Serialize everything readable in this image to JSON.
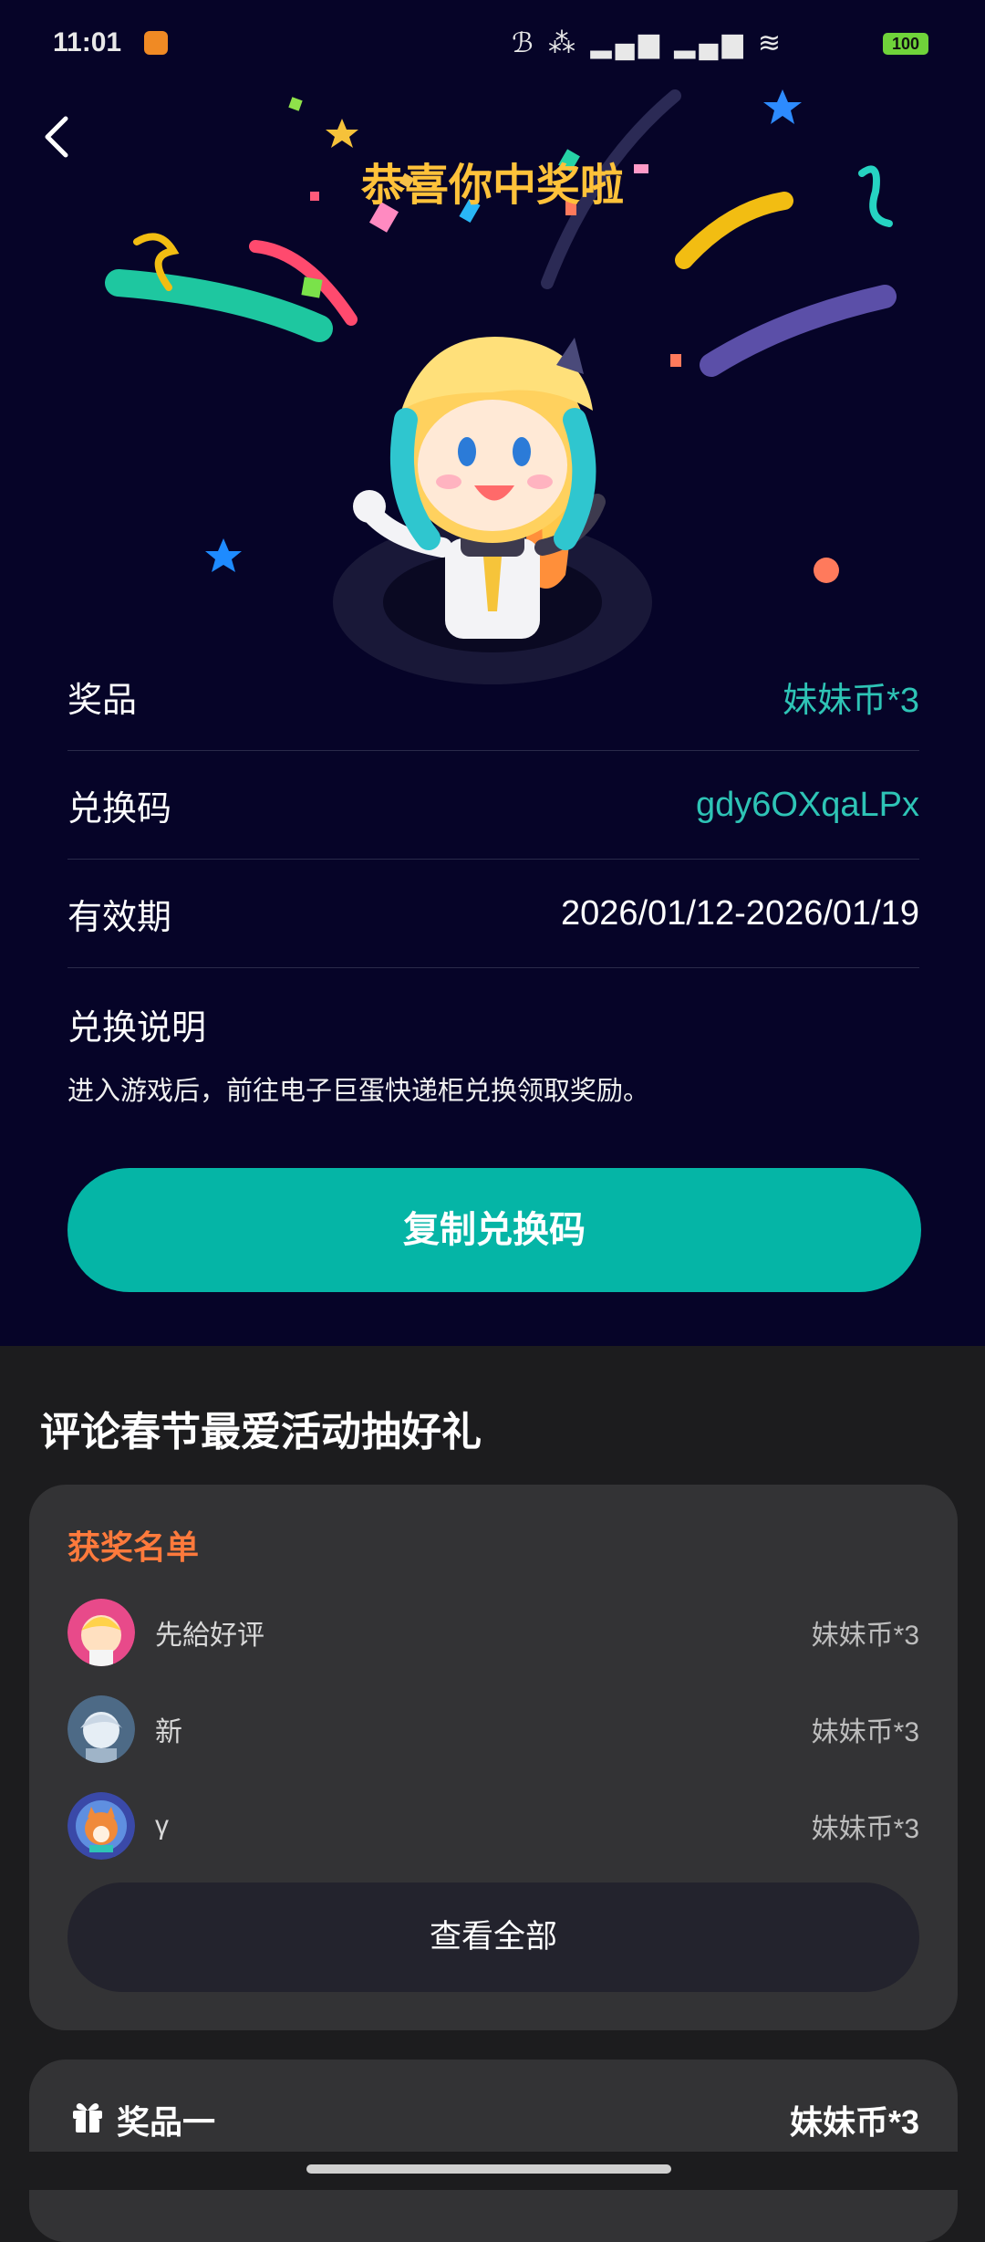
{
  "status_bar": {
    "time": "11:01",
    "signal": "ℬ ⁂ ▂▄▆ ▂▄▆ ≋",
    "battery": "100"
  },
  "hero": {
    "title": "恭喜你中奖啦",
    "rows": [
      {
        "label": "奖品",
        "value": "妹妹币*3"
      },
      {
        "label": "兑换码",
        "value": "gdy6OXqaLPx"
      },
      {
        "label": "有效期",
        "value": "2026/01/12-2026/01/19"
      }
    ],
    "desc_label": "兑换说明",
    "desc_text": "进入游戏后，前往电子巨蛋快递柜兑换领取奖励。",
    "copy_button": "复制兑换码"
  },
  "colors": {
    "accent": "#05b5a6",
    "title": "#ffc23a",
    "winners_title": "#ff7a3c",
    "hero_bg": "#060428"
  },
  "activity": {
    "title": "评论春节最爱活动抽好礼",
    "winners_title": "获奖名单",
    "winners": [
      {
        "name": "先給好评",
        "prize": "妹妹币*3"
      },
      {
        "name": "新",
        "prize": "妹妹币*3"
      },
      {
        "name": "γ",
        "prize": "妹妹币*3"
      }
    ],
    "view_all": "查看全部"
  },
  "prize_card": {
    "label": "奖品一",
    "value": "妹妹币*3",
    "icon": "gift-icon"
  }
}
